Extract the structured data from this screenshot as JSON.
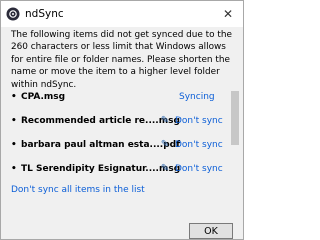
{
  "window": {
    "title": "ndSync",
    "close_glyph": "✕"
  },
  "message": "The following items did not get synced due to the 260 characters or less limit that Windows allows for entire file or folder names. Please shorten the name or move the item to a higher level folder within ndSync.",
  "items": [
    {
      "bullet": "•",
      "name": "CPA.msg",
      "status": "Syncing",
      "has_edit_icon": false
    },
    {
      "bullet": "•",
      "name": "Recommended article re....msg",
      "status": "Don't sync",
      "has_edit_icon": true
    },
    {
      "bullet": "•",
      "name": "barbara paul altman esta....pdf",
      "status": "Don't sync",
      "has_edit_icon": true
    },
    {
      "bullet": "•",
      "name": "TL Serendipity Esignatur....msg",
      "status": "Don't sync",
      "has_edit_icon": true
    }
  ],
  "dont_sync_all_label": "Don't sync all items in the list",
  "ok_label": "OK",
  "icons": {
    "app": "ndsync-logo-icon",
    "edit": "pencil-icon"
  },
  "colors": {
    "link": "#0b5ed7",
    "edit_icon": "#3a6fb0"
  }
}
